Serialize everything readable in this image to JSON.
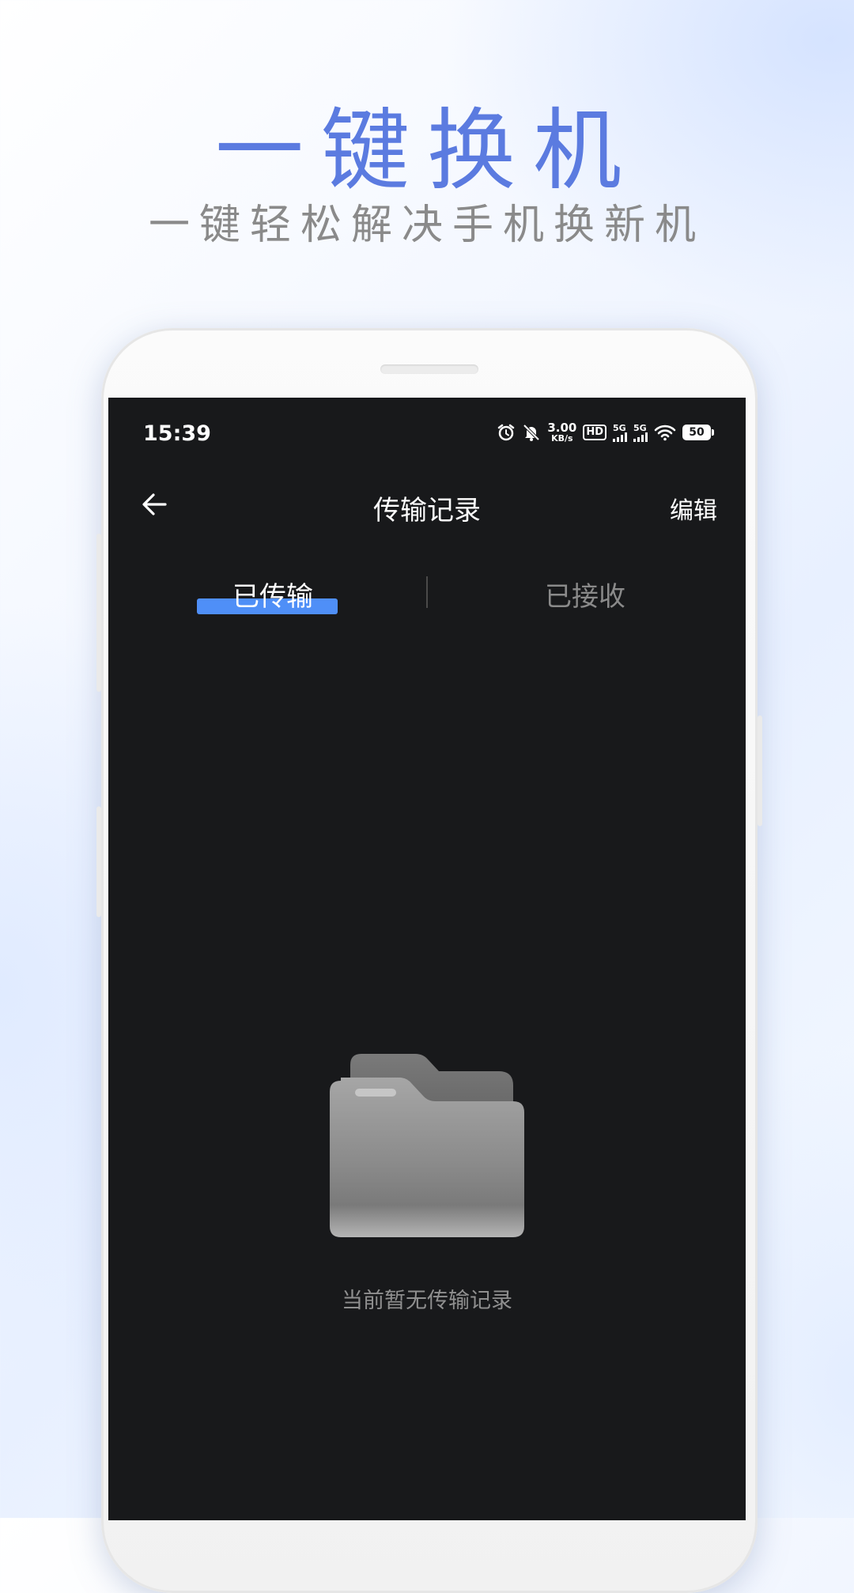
{
  "promo": {
    "headline": "一键换机",
    "subline": "一键轻松解决手机换新机"
  },
  "status_bar": {
    "time": "15:39",
    "net_speed_value": "3.00",
    "net_speed_unit": "KB/s",
    "hd_label": "HD",
    "signal1_label": "5G",
    "signal2_label": "5G",
    "battery": "50"
  },
  "app_bar": {
    "title": "传输记录",
    "edit_label": "编辑"
  },
  "tabs": [
    {
      "label": "已传输",
      "active": true
    },
    {
      "label": "已接收",
      "active": false
    }
  ],
  "empty_state": {
    "message": "当前暂无传输记录"
  },
  "colors": {
    "accent": "#4f8ff7",
    "headline": "#5b7be0",
    "screen_bg": "#18191b"
  }
}
